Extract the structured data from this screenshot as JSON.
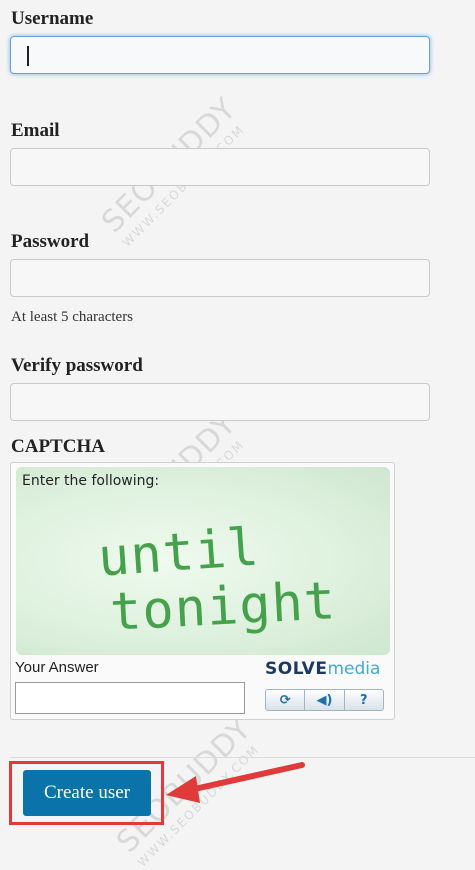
{
  "form": {
    "username_label": "Username",
    "email_label": "Email",
    "password_label": "Password",
    "password_hint": "At least 5 characters",
    "verify_label": "Verify password",
    "captcha_label": "CAPTCHA"
  },
  "captcha": {
    "instruction": "Enter the following:",
    "phrase_line1": "until",
    "phrase_line2": "tonight",
    "answer_label": "Your Answer",
    "brand_part1": "SOLVE",
    "brand_part2": "media",
    "buttons": [
      {
        "icon": "refresh-icon",
        "glyph": "⟳"
      },
      {
        "icon": "audio-icon",
        "glyph": "◀)"
      },
      {
        "icon": "help-icon",
        "glyph": "?"
      }
    ]
  },
  "submit": {
    "label": "Create user"
  },
  "watermark": {
    "brand": "SEOBUDDY",
    "url": "WWW.SEOBUDDY.COM"
  },
  "annotation": {
    "color": "#e03a3a"
  }
}
